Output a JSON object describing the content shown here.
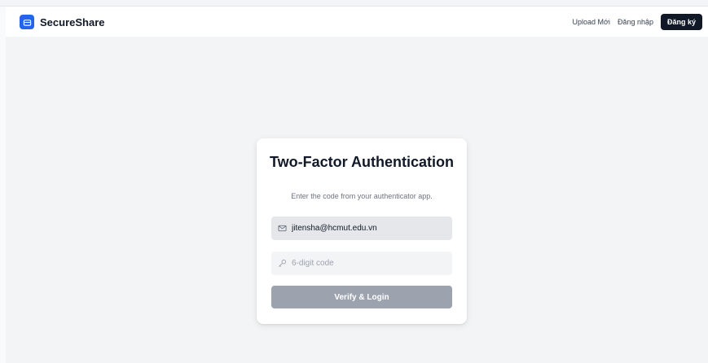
{
  "header": {
    "brand": "SecureShare",
    "nav": {
      "upload_label": "Upload Mới",
      "login_label": "Đăng nhập",
      "signup_label": "Đăng ký"
    }
  },
  "card": {
    "title": "Two-Factor Authentication",
    "subtitle": "Enter the code from your authenticator app.",
    "email": {
      "value": "jitensha@hcmut.edu.vn",
      "icon": "mail-icon"
    },
    "code": {
      "placeholder": "6-digit code",
      "icon": "key-icon"
    },
    "submit_label": "Verify & Login"
  },
  "colors": {
    "brand": "#2563eb",
    "primary_dark": "#111827",
    "button_disabled": "#9ca3af"
  }
}
